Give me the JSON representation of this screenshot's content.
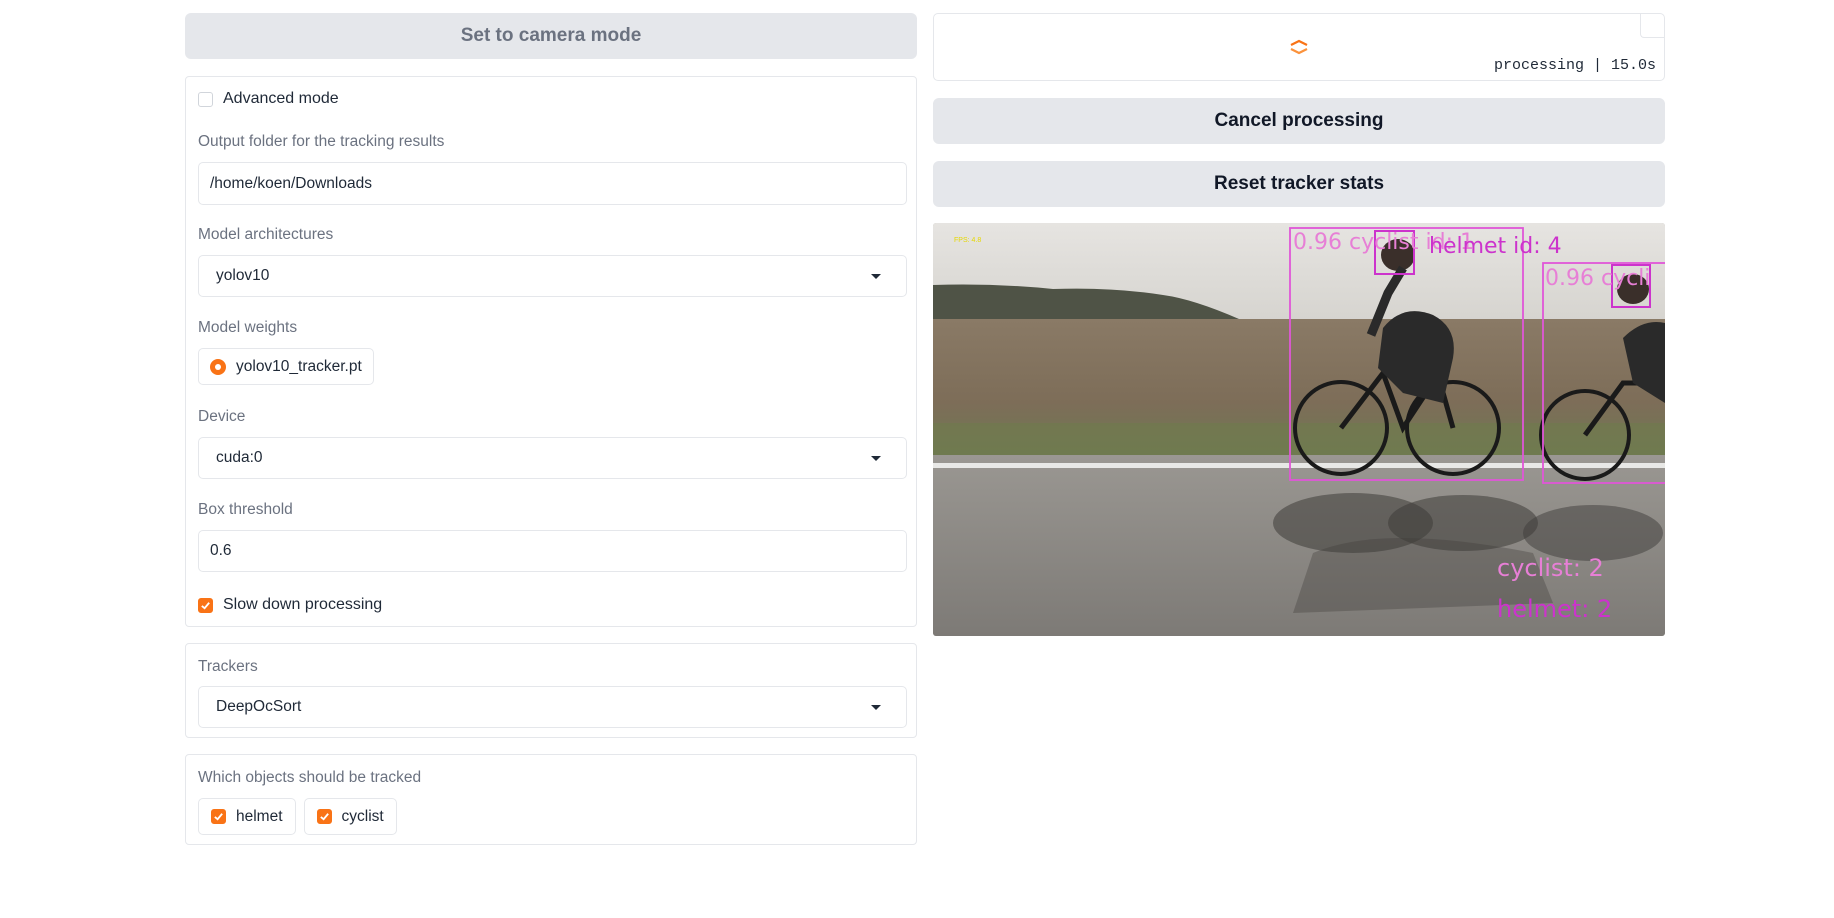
{
  "camera_button": {
    "label": "Set to camera mode"
  },
  "settings": {
    "advanced_mode": {
      "label": "Advanced mode",
      "checked": false
    },
    "output_folder": {
      "label": "Output folder for the tracking results",
      "value": "/home/koen/Downloads"
    },
    "model_architectures": {
      "label": "Model architectures",
      "selected": "yolov10"
    },
    "model_weights": {
      "label": "Model weights",
      "option": "yolov10_tracker.pt",
      "selected": true
    },
    "device": {
      "label": "Device",
      "selected": "cuda:0"
    },
    "box_threshold": {
      "label": "Box threshold",
      "value": "0.6"
    },
    "slow_down": {
      "label": "Slow down processing",
      "checked": true
    }
  },
  "trackers": {
    "label": "Trackers",
    "selected": "DeepOcSort"
  },
  "objects": {
    "label": "Which objects should be tracked",
    "options": [
      {
        "label": "helmet",
        "checked": true
      },
      {
        "label": "cyclist",
        "checked": true
      }
    ]
  },
  "status": {
    "text": "processing | 15.0s"
  },
  "cancel_button": {
    "label": "Cancel processing"
  },
  "reset_button": {
    "label": "Reset tracker stats"
  },
  "video": {
    "fps_label": "FPS: 4.8",
    "detections": [
      {
        "label": "0.96 cyclist id: 1",
        "class": "cyclist"
      },
      {
        "label": "helmet id: 4",
        "class": "helmet"
      },
      {
        "label": "0.96 cycli",
        "class": "cyclist"
      }
    ],
    "counts": [
      {
        "label": "cyclist: 2"
      },
      {
        "label": "helmet: 2"
      }
    ]
  },
  "colors": {
    "accent": "#f97316",
    "detection_box": "#e056d8",
    "helmet_box": "#cc33cc"
  }
}
